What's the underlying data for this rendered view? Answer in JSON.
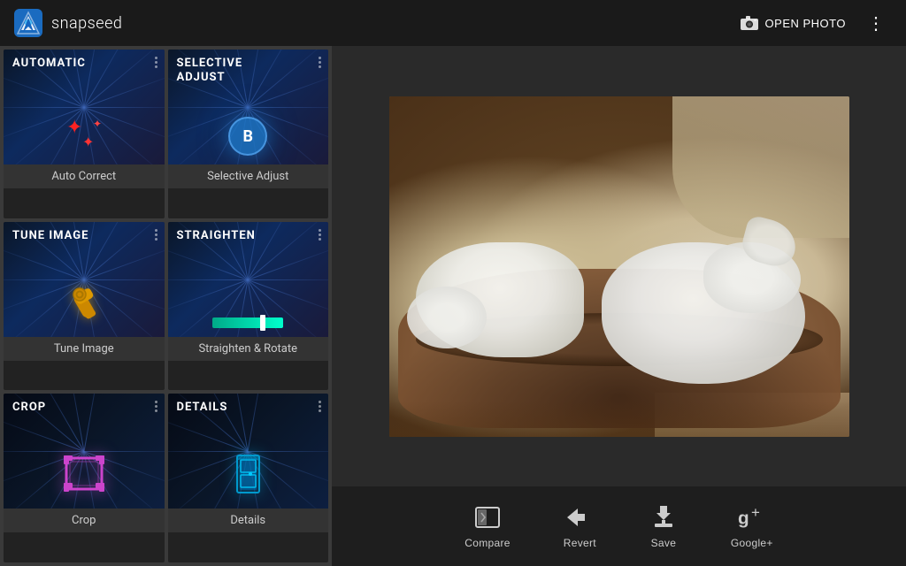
{
  "app": {
    "name": "snapseed"
  },
  "header": {
    "open_photo_label": "OPEN PHOTO",
    "more_label": "⋮"
  },
  "tools": [
    {
      "id": "auto-correct",
      "top_label": "AUTOMATIC",
      "name_label": "Auto Correct",
      "thumb_class": "thumb-auto",
      "icon_type": "stars"
    },
    {
      "id": "selective-adjust",
      "top_label": "SELECTIVE\nADJUST",
      "name_label": "Selective Adjust",
      "thumb_class": "thumb-selective",
      "icon_type": "b-circle"
    },
    {
      "id": "tune-image",
      "top_label": "TUNE IMAGE",
      "name_label": "Tune Image",
      "thumb_class": "thumb-tune",
      "icon_type": "wrench"
    },
    {
      "id": "straighten",
      "top_label": "STRAIGHTEN",
      "name_label": "Straighten & Rotate",
      "thumb_class": "thumb-straighten",
      "icon_type": "level"
    },
    {
      "id": "crop",
      "top_label": "CROP",
      "name_label": "Crop",
      "thumb_class": "thumb-crop",
      "icon_type": "crop"
    },
    {
      "id": "details",
      "top_label": "DETAILS",
      "name_label": "Details",
      "thumb_class": "thumb-details",
      "icon_type": "details"
    }
  ],
  "bottom_toolbar": {
    "compare_label": "Compare",
    "revert_label": "Revert",
    "save_label": "Save",
    "google_plus_label": "Google+"
  }
}
